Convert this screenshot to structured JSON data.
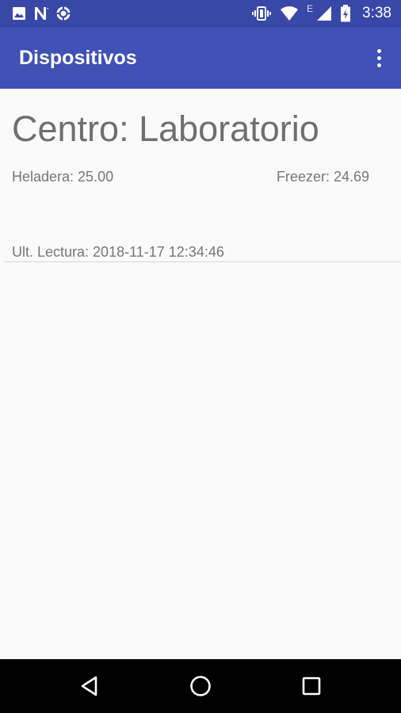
{
  "status_bar": {
    "time": "3:38",
    "network_label": "E",
    "left_icons": [
      "image-icon",
      "n-app-icon",
      "sync-icon"
    ],
    "right_icons": [
      "vibrate-icon",
      "wifi-icon",
      "signal-icon",
      "battery-icon"
    ]
  },
  "app_bar": {
    "title": "Dispositivos",
    "menu_icon": "more-vert-icon"
  },
  "device": {
    "center": "Centro: Laboratorio",
    "fridge": "Heladera: 25.00",
    "freezer": "Freezer: 24.69",
    "last_reading": "Ult. Lectura: 2018-11-17 12:34:46"
  },
  "nav_bar": {
    "buttons": [
      "back-icon",
      "home-icon",
      "recents-icon"
    ]
  },
  "colors": {
    "primary": "#3f51b5",
    "primary_dark": "#3848a8",
    "background": "#fafafa",
    "text_secondary": "#777777"
  }
}
